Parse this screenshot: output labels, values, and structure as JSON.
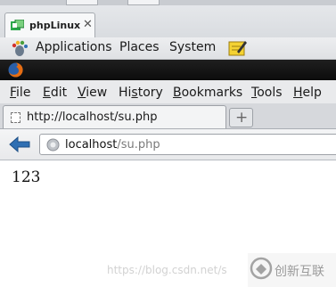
{
  "vm_tab": {
    "label": "phpLinux",
    "close": "✕"
  },
  "gnome_panel": {
    "menus": [
      "Applications",
      "Places",
      "System"
    ]
  },
  "firefox": {
    "menubar": [
      {
        "first": "F",
        "rest": "ile"
      },
      {
        "first": "E",
        "rest": "dit"
      },
      {
        "first": "V",
        "rest": "iew"
      },
      {
        "first": "",
        "pre": "Hi",
        "u": "s",
        "post": "tory"
      },
      {
        "first": "B",
        "rest": "ookmarks"
      },
      {
        "first": "T",
        "rest": "ools"
      },
      {
        "first": "H",
        "rest": "elp"
      }
    ],
    "tab_title": "http://localhost/su.php",
    "new_tab_label": "+",
    "url_host": "localhost",
    "url_path": "/su.php"
  },
  "page": {
    "output": "123"
  },
  "watermark": {
    "text": "https://blog.csdn.net/s",
    "brand": "创新互联"
  },
  "colors": {
    "titlebar": "#111111",
    "accent": "#2f6fb3"
  }
}
